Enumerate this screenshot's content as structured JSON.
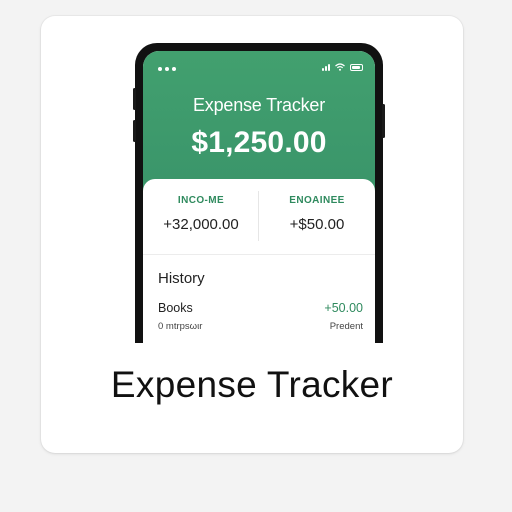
{
  "app": {
    "title": "Expense Tracker",
    "balance": "$1,250.00"
  },
  "summary": {
    "income_label": "INCO-ME",
    "income_value": "+32,000.00",
    "expense_label": "ENOAINEE",
    "expense_value": "+$50.00"
  },
  "history": {
    "title": "History",
    "items": [
      {
        "name": "Books",
        "amount": "+50.00",
        "subtitle": "0 mtrpsωιr",
        "status": "Predent"
      }
    ]
  },
  "caption": "Expense Tracker",
  "icons": {
    "status_dots": "dots-icon",
    "signal": "signal-icon",
    "wifi": "wifi-icon",
    "battery": "battery-icon"
  },
  "colors": {
    "brand_green": "#3d9b6a",
    "accent_text_green": "#2f8a5e",
    "card_bg": "#ffffff",
    "page_bg": "#f3f3f3"
  }
}
